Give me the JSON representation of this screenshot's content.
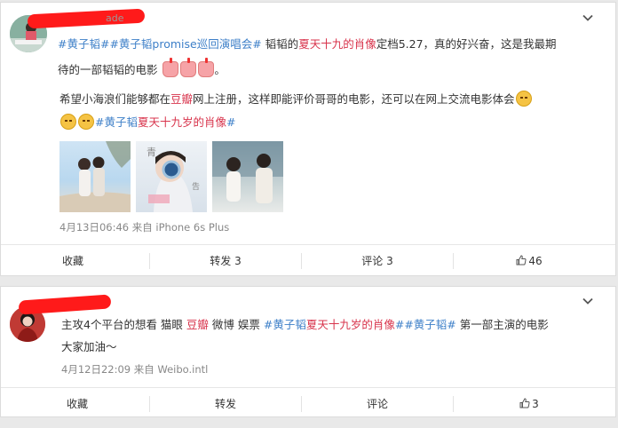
{
  "post1": {
    "name_partial": "ade",
    "line1": {
      "tag1": "#黄子韬#",
      "tag2": "#黄子韬promise巡回演唱会#",
      "text_a": " 韬韬的",
      "movie": "夏天十九的肖像",
      "text_b": "定档5.27，真的好兴奋，这是我最期"
    },
    "line2": "待的一部韬韬的电影",
    "line3": {
      "text_a": "希望小海浪们能够都在",
      "douban": "豆瓣",
      "text_b": "网上注册，这样即能评价哥哥的电影，还可以在网上交流电影体会"
    },
    "line4": {
      "tag_a": "#黄子韬",
      "movie": "夏天十九岁的肖像",
      "tag_b": "#"
    },
    "meta": "4月13日06:46 来自 iPhone 6s Plus",
    "actions": {
      "collect": "收藏",
      "repost": "转发 3",
      "comment": "评论 3",
      "like": "46"
    }
  },
  "post2": {
    "line1": {
      "text_a": "主攻4个平台的想看 猫眼 ",
      "douban": "豆瓣",
      "text_b": " 微博 娱票 ",
      "tag_a": "#黄子韬",
      "movie": "夏天十九岁的肖像",
      "tag_b": "##黄子韬#",
      "text_c": " 第一部主演的电影"
    },
    "line2": "大家加油～",
    "meta": "4月12日22:09 来自 Weibo.intl",
    "actions": {
      "collect": "收藏",
      "repost": "转发",
      "comment": "评论",
      "like": "3"
    }
  },
  "icons": {
    "chevron": "chevron-down-icon",
    "like": "thumbs-up-icon",
    "face_emoji": "grin-face-emoji-icon",
    "cake_emoji": "cake-emoji-icon"
  },
  "colors": {
    "link": "#3d7fc8",
    "hot": "#d8344c",
    "redact": "#ff1a1a"
  }
}
